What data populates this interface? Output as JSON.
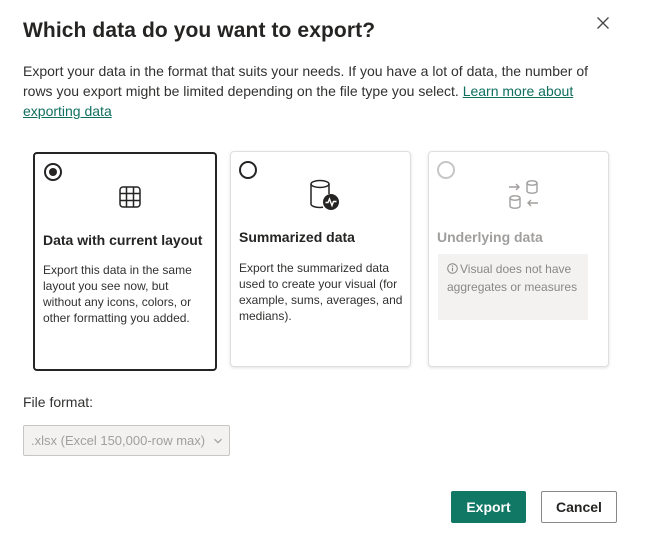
{
  "dialog": {
    "title": "Which data do you want to export?",
    "description": "Export your data in the format that suits your needs. If you have a lot of data, the number of rows you export might be limited depending on the file type you select.",
    "learn_more_link": "Learn more about exporting data"
  },
  "options": [
    {
      "title": "Data with current layout",
      "description": "Export this data in the same layout you see now, but without any icons, colors, or other formatting you added.",
      "selected": true,
      "icon": "table-grid-icon"
    },
    {
      "title": "Summarized data",
      "description": "Export the summarized data used to create your visual (for example, sums, averages, and medians).",
      "selected": false,
      "icon": "database-chart-icon"
    },
    {
      "title": "Underlying data",
      "note": "Visual does not have aggregates or measures",
      "disabled": true,
      "icon": "database-transfer-icon"
    }
  ],
  "file_format": {
    "label": "File format:",
    "value": ".xlsx (Excel 150,000-row max)"
  },
  "buttons": {
    "export": "Export",
    "cancel": "Cancel"
  },
  "colors": {
    "primary": "#117865",
    "link": "#0f6f5f"
  }
}
